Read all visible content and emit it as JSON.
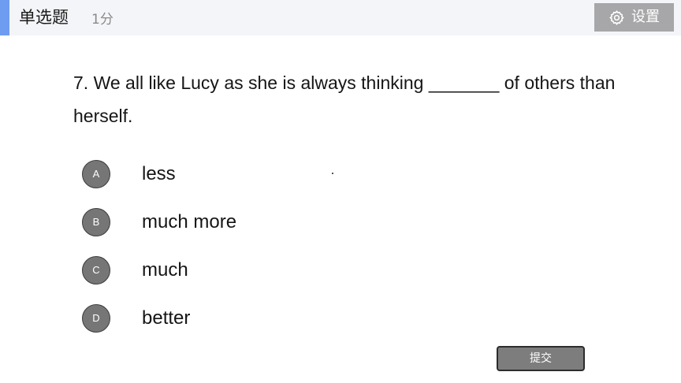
{
  "header": {
    "question_type": "单选题",
    "score": "1分",
    "settings_label": "设置",
    "settings_icon": "gear-icon",
    "accent_color": "#6e9cf0"
  },
  "question": {
    "text": "7. We all like Lucy as she is always thinking _______ of others than herself."
  },
  "options": [
    {
      "letter": "A",
      "text": "less"
    },
    {
      "letter": "B",
      "text": "much more"
    },
    {
      "letter": "C",
      "text": "much"
    },
    {
      "letter": "D",
      "text": "better"
    }
  ],
  "submit": {
    "label": "提交"
  }
}
